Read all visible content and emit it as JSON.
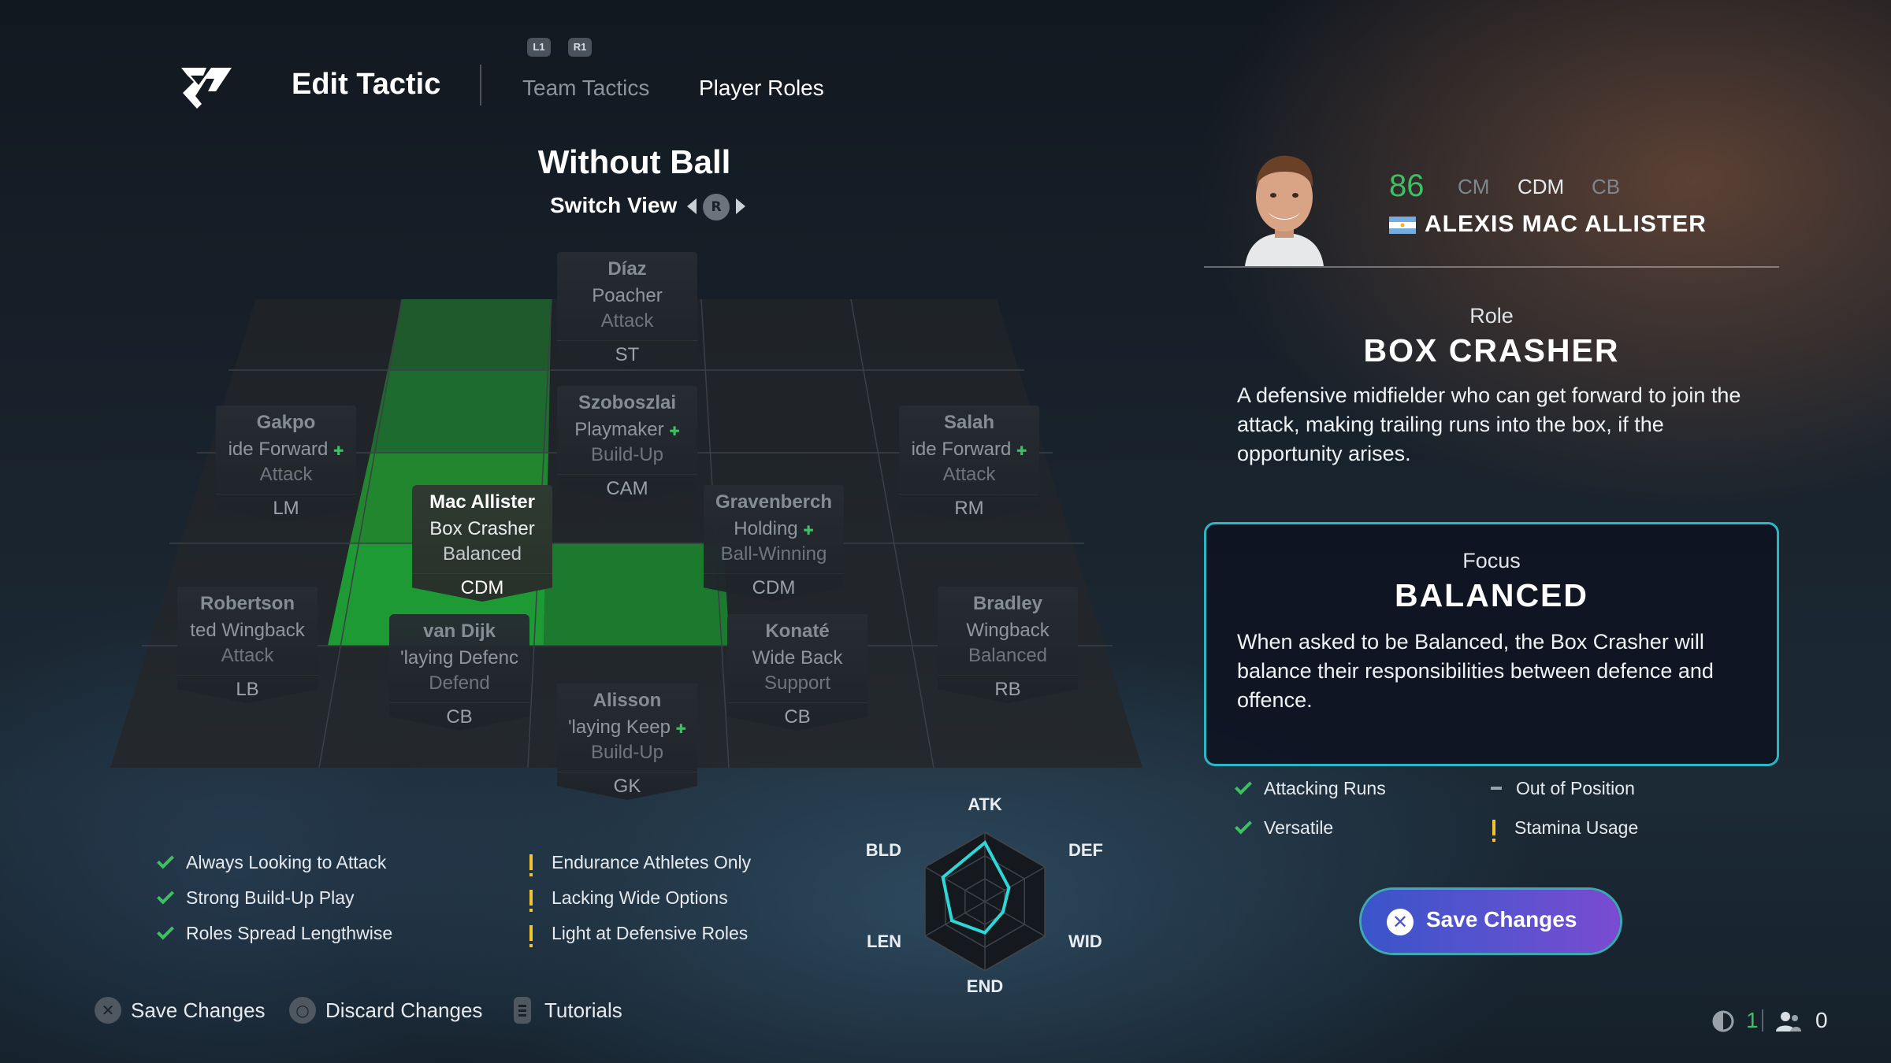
{
  "header": {
    "title": "Edit Tactic",
    "shoulder_left": "L1",
    "shoulder_right": "R1",
    "tabs": [
      {
        "label": "Team Tactics",
        "active": false
      },
      {
        "label": "Player Roles",
        "active": true
      }
    ]
  },
  "view": {
    "title": "Without Ball",
    "switch_label": "Switch View",
    "switch_button": "R"
  },
  "players": [
    {
      "name": "Díaz",
      "role": "Poacher",
      "focus": "Attack",
      "position": "ST",
      "plus": false,
      "selected": false
    },
    {
      "name": "Szoboszlai",
      "role": "Playmaker",
      "focus": "Build-Up",
      "position": "CAM",
      "plus": true,
      "selected": false
    },
    {
      "name": "Gakpo",
      "role": "ide Forward",
      "focus": "Attack",
      "position": "LM",
      "plus": true,
      "selected": false
    },
    {
      "name": "Salah",
      "role": "ide Forward",
      "focus": "Attack",
      "position": "RM",
      "plus": true,
      "selected": false
    },
    {
      "name": "Mac Allister",
      "role": "Box Crasher",
      "focus": "Balanced",
      "position": "CDM",
      "plus": false,
      "selected": true
    },
    {
      "name": "Gravenberch",
      "role": "Holding",
      "focus": "Ball-Winning",
      "position": "CDM",
      "plus": true,
      "selected": false
    },
    {
      "name": "Robertson",
      "role": "ted Wingback",
      "focus": "Attack",
      "position": "LB",
      "plus": false,
      "selected": false
    },
    {
      "name": "van Dijk",
      "role": "'laying Defenc",
      "focus": "Defend",
      "position": "CB",
      "plus": false,
      "selected": false
    },
    {
      "name": "Konaté",
      "role": "Wide Back",
      "focus": "Support",
      "position": "CB",
      "plus": false,
      "selected": false
    },
    {
      "name": "Bradley",
      "role": "Wingback",
      "focus": "Balanced",
      "position": "RB",
      "plus": false,
      "selected": false
    },
    {
      "name": "Alisson",
      "role": "'laying Keep",
      "focus": "Build-Up",
      "position": "GK",
      "plus": true,
      "selected": false
    }
  ],
  "tactic_strengths": [
    "Always Looking to Attack",
    "Strong Build-Up Play",
    "Roles Spread Lengthwise"
  ],
  "tactic_warnings": [
    "Endurance Athletes Only",
    "Lacking Wide Options",
    "Light at Defensive Roles"
  ],
  "radar": {
    "labels": {
      "top": "ATK",
      "top_right": "DEF",
      "bottom_right": "WID",
      "bottom": "END",
      "bottom_left": "LEN",
      "top_left": "BLD"
    },
    "values": {
      "ATK": 0.85,
      "DEF": 0.4,
      "WID": 0.3,
      "END": 0.45,
      "LEN": 0.55,
      "BLD": 0.7
    },
    "accent": "#2fd6d8"
  },
  "selected_player": {
    "rating": "86",
    "positions": [
      "CM",
      "CDM",
      "CB"
    ],
    "name": "ALEXIS MAC ALLISTER",
    "role_label": "Role",
    "role_name": "BOX CRASHER",
    "role_description": "A defensive midfielder who can get forward to join the attack, making trailing runs into the box, if the opportunity arises.",
    "focus_label": "Focus",
    "focus_name": "BALANCED",
    "focus_description": "When asked to be Balanced, the Box Crasher will balance their responsibilities between defence and offence.",
    "traits": [
      {
        "label": "Attacking Runs",
        "icon": "check-icon"
      },
      {
        "label": "Out of Position",
        "icon": "dash-icon"
      },
      {
        "label": "Versatile",
        "icon": "check-icon"
      },
      {
        "label": "Stamina Usage",
        "icon": "warning-icon"
      }
    ],
    "save_button": "Save Changes"
  },
  "footer": {
    "save_label": "Save Changes",
    "discard_label": "Discard Changes",
    "tutorials_label": "Tutorials",
    "network_count": "1",
    "friends_count": "0"
  },
  "colors": {
    "accent_green": "#3fbf63",
    "accent_cyan": "#2bb6c4",
    "warning_yellow": "#f2c530",
    "button_gradient_start": "#3a54c9",
    "button_gradient_end": "#7b4bd1"
  }
}
